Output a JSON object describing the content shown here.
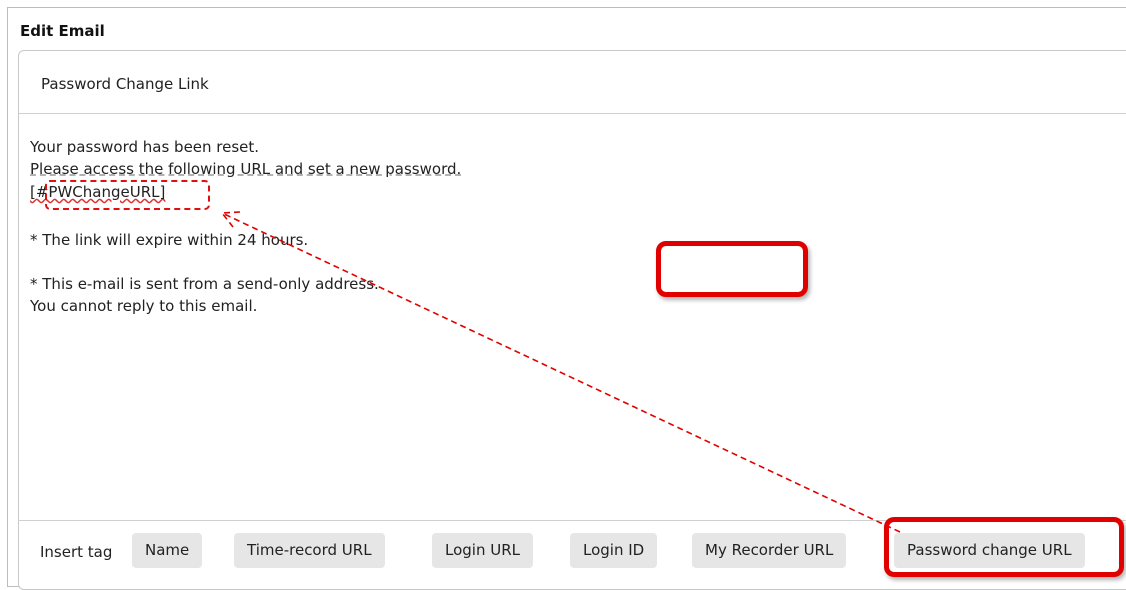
{
  "header": {
    "title": "Edit Email"
  },
  "subject": {
    "value": "Password Change Link"
  },
  "email_body": {
    "lines": [
      "Your password has been reset.",
      "Please access the following URL and set a new password.",
      "[#PWChangeURL]",
      "* The link will expire within 24 hours.",
      "* This e-mail is sent from a send-only address.",
      "You cannot reply to this email."
    ]
  },
  "toolbar": {
    "insert_label": "Insert tag",
    "buttons": [
      "Name",
      "Time-record URL",
      "Login URL",
      "Login ID",
      "My Recorder URL",
      "Password change URL"
    ]
  },
  "annotation": {
    "color": "#e00000"
  }
}
